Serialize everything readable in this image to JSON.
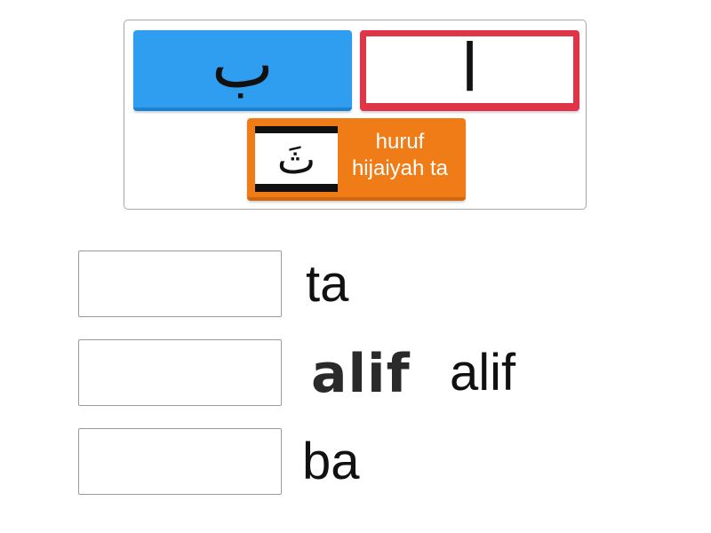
{
  "bank": {
    "tiles": [
      {
        "glyph": "ب",
        "color": "#2f9ef0"
      },
      {
        "glyph": "ا",
        "color": "#e03549"
      },
      {
        "image_glyph": "ثَ",
        "label_line1": "huruf",
        "label_line2": "hijaiyah ta",
        "color": "#f07c18"
      }
    ]
  },
  "targets": [
    {
      "answer": "ta"
    },
    {
      "image_text": "alif",
      "answer": "alif"
    },
    {
      "answer": "ba"
    }
  ]
}
